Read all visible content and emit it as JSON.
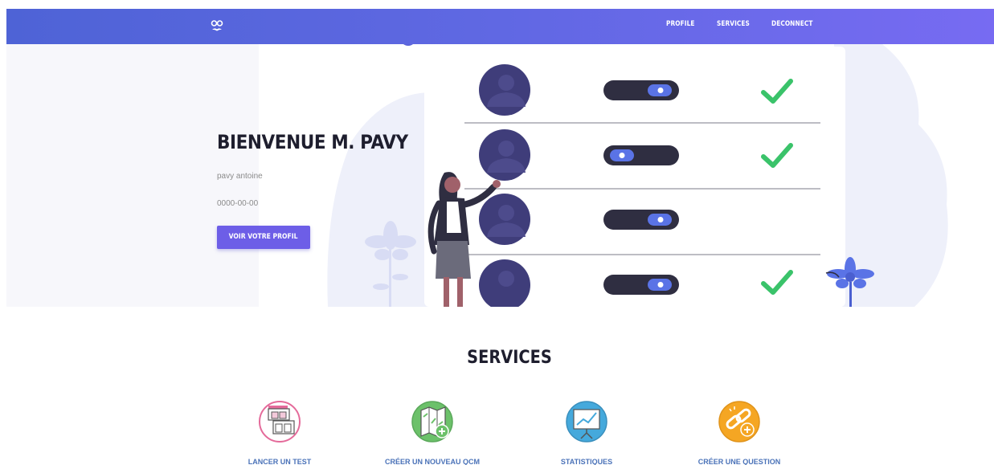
{
  "navbar": {
    "logo_icon": "glasses-mustache-icon",
    "links": [
      {
        "label": "PROFILE"
      },
      {
        "label": "SERVICES"
      },
      {
        "label": "DECONNECT"
      }
    ]
  },
  "hero": {
    "title": "BIENVENUE M. PAVY",
    "name": "pavy antoine",
    "date": "0000-00-00",
    "profile_button_label": "VOIR VOTRE PROFIL"
  },
  "services": {
    "title": "SERVICES",
    "items": [
      {
        "label": "LANCER UN TEST",
        "icon": "layout-test-icon"
      },
      {
        "label": "CRÉER UN NOUVEAU QCM",
        "icon": "map-add-icon"
      },
      {
        "label": "STATISTIQUES",
        "icon": "presentation-chart-icon"
      },
      {
        "label": "CRÉER UNE QUESTION",
        "icon": "chain-link-add-icon"
      }
    ]
  },
  "colors": {
    "nav_start": "#4e63d6",
    "nav_end": "#776bf2",
    "button": "#6d5ee7",
    "service_label": "#4a72b8",
    "check": "#3ac36a",
    "avatar": "#3f3d7a",
    "toggle": "#2f2e41",
    "toggle_knob": "#5a73e6"
  }
}
